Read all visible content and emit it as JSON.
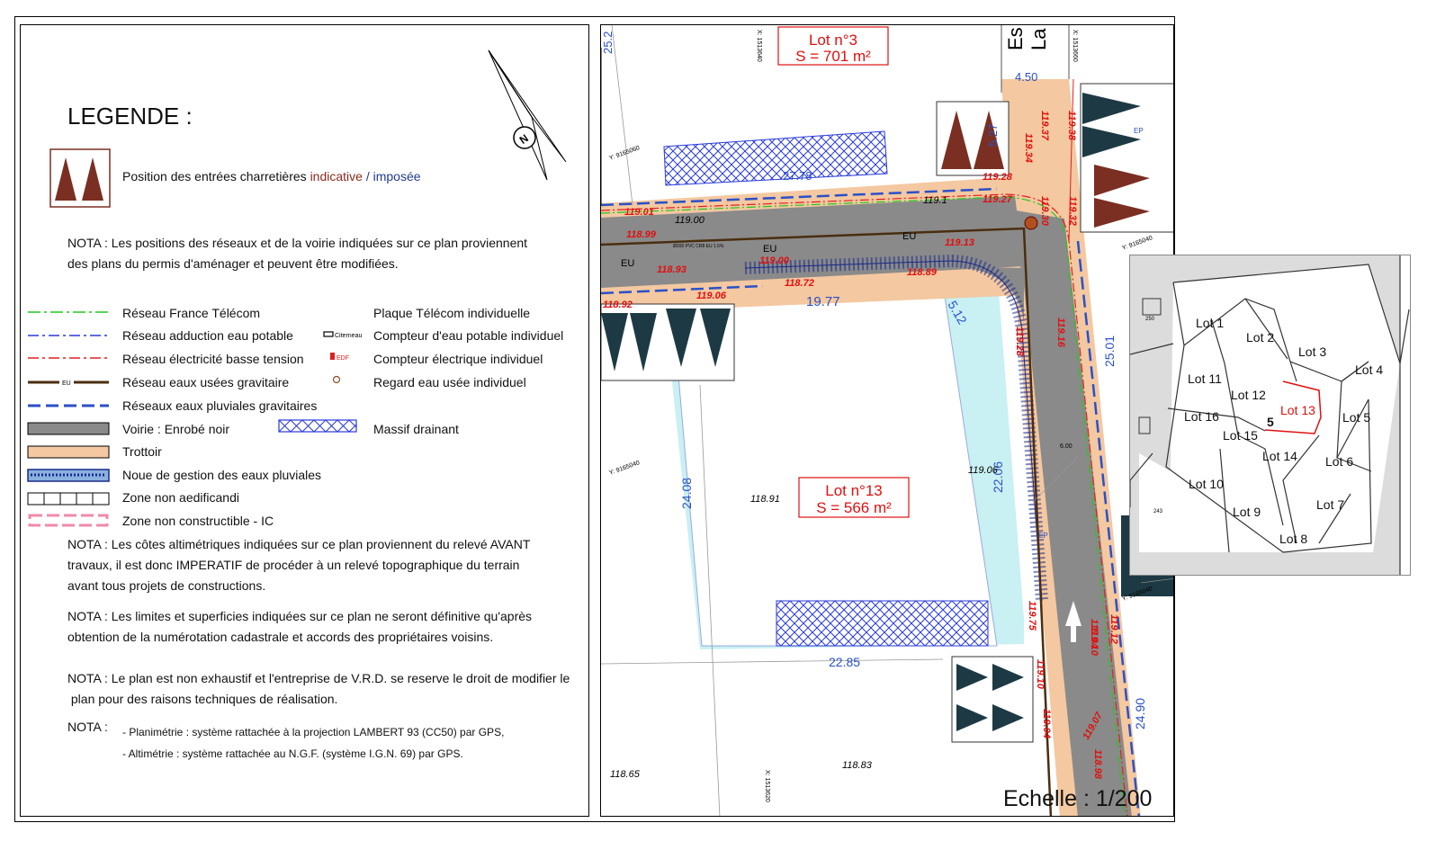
{
  "legend": {
    "title": "LEGENDE :",
    "entrances": {
      "prefix": "Position des entrées charretières",
      "indicative": "indicative",
      "sep": " / ",
      "imposed": "imposée"
    },
    "nota1_l1": "NOTA : Les positions des réseaux et de la voirie indiquées sur ce plan proviennent",
    "nota1_l2": "des plans du permis d'aménager et peuvent être modifiées.",
    "items_left": [
      "Réseau France Télécom",
      "Réseau adduction eau potable",
      "Réseau électricité basse tension",
      "Réseau eaux usées gravitaire",
      "Réseaux eaux pluviales gravitaires",
      "Voirie : Enrobé noir",
      "Trottoir",
      "Noue de gestion des eaux pluviales",
      "Zone non aedificandi",
      "Zone non constructible - IC"
    ],
    "items_right": [
      "Plaque Télécom individuelle",
      "Compteur d'eau potable individuel",
      "Compteur électrique individuel",
      "Regard eau usée individuel",
      "Massif drainant"
    ],
    "symbol_citerneau": "Citerneau",
    "symbol_edf": "EDF",
    "symbol_eu": "EU",
    "nota2": [
      "NOTA : Les côtes altimétriques indiquées sur ce plan proviennent du relevé AVANT",
      "travaux, il est donc IMPERATIF de procéder à un relevé topographique du terrain",
      "avant tous projets de constructions."
    ],
    "nota3": [
      "NOTA : Les limites et superficies indiquées sur ce plan ne seront définitive qu'après",
      "obtention de la numérotation cadastrale et accords des propriétaires voisins."
    ],
    "nota4": [
      "NOTA : Le plan est non exhaustif et l'entreprise de V.R.D. se reserve le droit de modifier le",
      " plan pour des raisons techniques de réalisation."
    ],
    "nota5_label": "NOTA :",
    "nota5_lines": [
      "- Planimétrie : système rattachée à la projection LAMBERT 93 (CC50) par GPS,",
      "- Altimétrie : système rattachée au N.G.F. (système I.G.N. 69) par GPS."
    ],
    "north": "N"
  },
  "map": {
    "lot3": {
      "name": "Lot n°3",
      "area": "S = 701 m²"
    },
    "lot13": {
      "name": "Lot n°13",
      "area": "S = 566 m²"
    },
    "scale": "Echelle : 1/200",
    "street_label_1": "Es",
    "street_label_2": "La",
    "dimensions": [
      "25.2",
      "4.50",
      "5.27",
      "27.78",
      "19.77",
      "5.12",
      "25.01",
      "24.08",
      "22.06",
      "22.85",
      "24.90",
      "6.00"
    ],
    "elevations_red": [
      "119.01",
      "118.99",
      "118.93",
      "119.00",
      "119.06",
      "118.92",
      "118.72",
      "118.89",
      "119.13",
      "119.28",
      "119.27",
      "119.34",
      "119.37",
      "119.38",
      "119.30",
      "119.32",
      "119.16",
      "119.28",
      "119.75",
      "119.04",
      "119.10",
      "119.12",
      "119.10",
      "119.04",
      "118.98",
      "119.07"
    ],
    "elevations_black": [
      "119.00",
      "119.1",
      "118.91",
      "119.06",
      "118.65",
      "118.83"
    ],
    "network_labels": {
      "eu": "EU",
      "ep": "EP",
      "pipe": "Ø200 PVC CR8 EU 1.5%"
    },
    "coordinates": [
      "X: 1513640",
      "Y: 9165060",
      "Y: 9165040",
      "X: 1513660",
      "Y: 9165040",
      "X: 1513620",
      "Y: 9165040"
    ]
  },
  "inset": {
    "lots": [
      "Lot 1",
      "Lot 2",
      "Lot 3",
      "Lot 4",
      "Lot 11",
      "Lot 12",
      "Lot 13",
      "Lot 5",
      "Lot 16",
      "Lot 15",
      "Lot 14",
      "Lot 6",
      "Lot 10",
      "Lot 9",
      "Lot 7",
      "Lot 8"
    ],
    "marker": "5",
    "parcels": [
      "250",
      "243"
    ]
  },
  "colors": {
    "road": "#8a8a8a",
    "sidewalk": "#f4c8a0",
    "swale": "#c9f0f2",
    "entrance_indicative": "#7a2f22",
    "entrance_imposed": "#1d3a44",
    "dimension_blue": "#2a50c8",
    "elevation_red": "#e01010"
  }
}
